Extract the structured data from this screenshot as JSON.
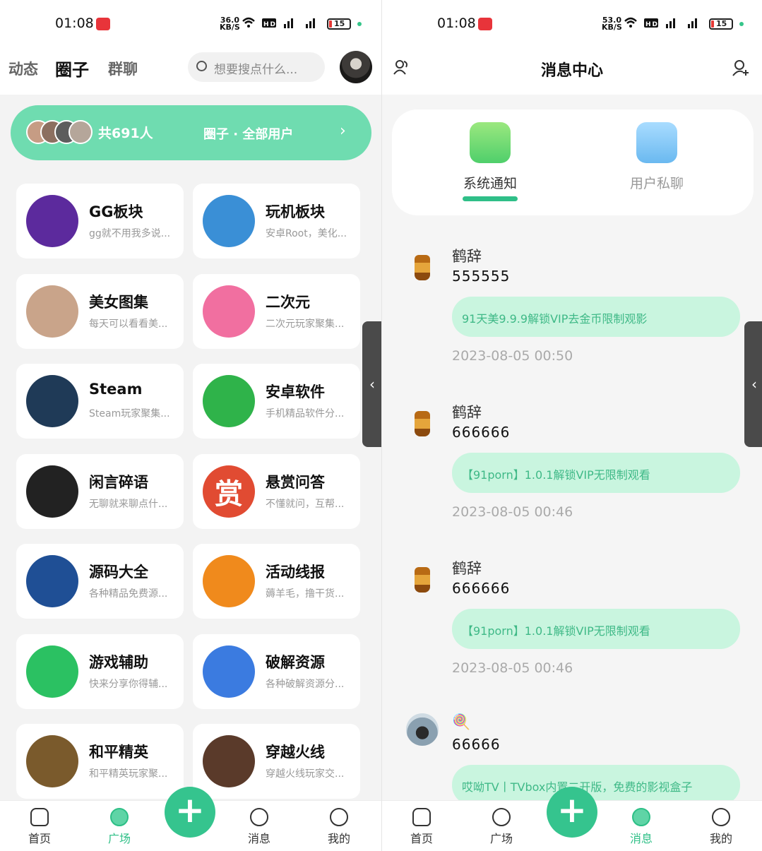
{
  "left": {
    "status": {
      "time": "01:08",
      "speed": "36.0",
      "speed_unit": "KB/S",
      "battery": "15"
    },
    "tabs": [
      {
        "label": "动态"
      },
      {
        "label": "圈子"
      },
      {
        "label": "群聊"
      }
    ],
    "search_placeholder": "想要搜点什么...",
    "banner": {
      "count": "共691人",
      "title": "圈子 · 全部用户",
      "chevron": "›"
    },
    "cards": [
      {
        "title": "GG板块",
        "desc": "gg就不用我多说...",
        "icon": "gg-logo-icon",
        "color": "#5c2a9d"
      },
      {
        "title": "玩机板块",
        "desc": "安卓Root，美化...",
        "icon": "gamepad-icon",
        "color": "#3a8fd6"
      },
      {
        "title": "美女图集",
        "desc": "每天可以看看美...",
        "icon": "photo-avatar-icon",
        "color": "#c9a48a"
      },
      {
        "title": "二次元",
        "desc": "二次元玩家聚集...",
        "icon": "bilibili-tv-icon",
        "color": "#f16fa0"
      },
      {
        "title": "Steam",
        "desc": "Steam玩家聚集...",
        "icon": "steam-icon",
        "color": "#1f3a57"
      },
      {
        "title": "安卓软件",
        "desc": "手机精品软件分...",
        "icon": "android-icon",
        "color": "#2fb34a"
      },
      {
        "title": "闲言碎语",
        "desc": "无聊就来聊点什...",
        "icon": "panda-meme-icon",
        "color": "#222222"
      },
      {
        "title": "悬赏问答",
        "desc": "不懂就问，互帮...",
        "icon": "reward-icon",
        "color": "#e14b32"
      },
      {
        "title": "源码大全",
        "desc": "各种精品免费源...",
        "icon": "html5-icon",
        "color": "#1f4f95"
      },
      {
        "title": "活动线报",
        "desc": "薅羊毛，撸干货...",
        "icon": "badge-check-icon",
        "color": "#f08a1c"
      },
      {
        "title": "游戏辅助",
        "desc": "快来分享你得辅...",
        "icon": "game-controller-icon",
        "color": "#2bc162"
      },
      {
        "title": "破解资源",
        "desc": "各种破解资源分...",
        "icon": "lock-icon",
        "color": "#3b7be0"
      },
      {
        "title": "和平精英",
        "desc": "和平精英玩家聚...",
        "icon": "pubg-icon",
        "color": "#7a5a2c"
      },
      {
        "title": "穿越火线",
        "desc": "穿越火线玩家交...",
        "icon": "crossfire-icon",
        "color": "#5a3a2a"
      }
    ],
    "reward_char": "赏",
    "nav": [
      {
        "label": "首页"
      },
      {
        "label": "广场"
      },
      {
        "label": "消息"
      },
      {
        "label": "我的"
      }
    ],
    "fab": "+"
  },
  "right": {
    "status": {
      "time": "01:08",
      "speed": "53.0",
      "speed_unit": "KB/S",
      "battery": "15"
    },
    "title": "消息中心",
    "tabs": [
      {
        "label": "系统通知"
      },
      {
        "label": "用户私聊"
      }
    ],
    "messages": [
      {
        "name": "鹤辞",
        "content": "555555",
        "bubble": "91天美9.9.9解锁VIP去金币限制观影",
        "time": "2023-08-05 00:50"
      },
      {
        "name": "鹤辞",
        "content": "666666",
        "bubble": "【91porn】1.0.1解锁VIP无限制观看",
        "time": "2023-08-05 00:46"
      },
      {
        "name": "鹤辞",
        "content": "666666",
        "bubble": "【91porn】1.0.1解锁VIP无限制观看",
        "time": "2023-08-05 00:46"
      },
      {
        "name": "🍭",
        "content": "66666",
        "bubble": "哎呦TV丨TVbox内置二开版，免费的影视盒子",
        "time": ""
      }
    ],
    "nav": [
      {
        "label": "首页"
      },
      {
        "label": "广场"
      },
      {
        "label": "消息"
      },
      {
        "label": "我的"
      }
    ],
    "fab": "+"
  },
  "handle_glyph": "‹"
}
